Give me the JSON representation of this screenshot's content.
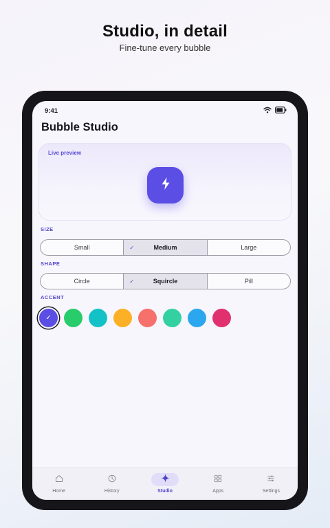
{
  "page": {
    "headline": "Studio, in detail",
    "subheadline": "Fine-tune every bubble"
  },
  "status_bar": {
    "time": "9:41",
    "icons": [
      "wifi-icon",
      "battery-icon"
    ]
  },
  "app": {
    "title": "Bubble Studio"
  },
  "preview": {
    "label": "Live preview",
    "bubble_icon": "lightning-bolt-icon",
    "bubble_color": "#5b4ee4"
  },
  "size": {
    "label": "SIZE",
    "options": [
      "Small",
      "Medium",
      "Large"
    ],
    "selected": "Medium"
  },
  "shape": {
    "label": "SHAPE",
    "options": [
      "Circle",
      "Squircle",
      "Pill"
    ],
    "selected": "Squircle"
  },
  "accent": {
    "label": "ACCENT",
    "colors": [
      "#5b4ee4",
      "#29cc6a",
      "#12c2c6",
      "#fbb026",
      "#f6706c",
      "#33d1a2",
      "#2aa7ee",
      "#e0316e"
    ],
    "selected_index": 0
  },
  "nav": {
    "items": [
      {
        "label": "Home",
        "icon": "home-icon"
      },
      {
        "label": "History",
        "icon": "clock-icon"
      },
      {
        "label": "Studio",
        "icon": "sparkle-icon"
      },
      {
        "label": "Apps",
        "icon": "grid-icon"
      },
      {
        "label": "Settings",
        "icon": "sliders-icon"
      }
    ],
    "active": "Studio"
  }
}
